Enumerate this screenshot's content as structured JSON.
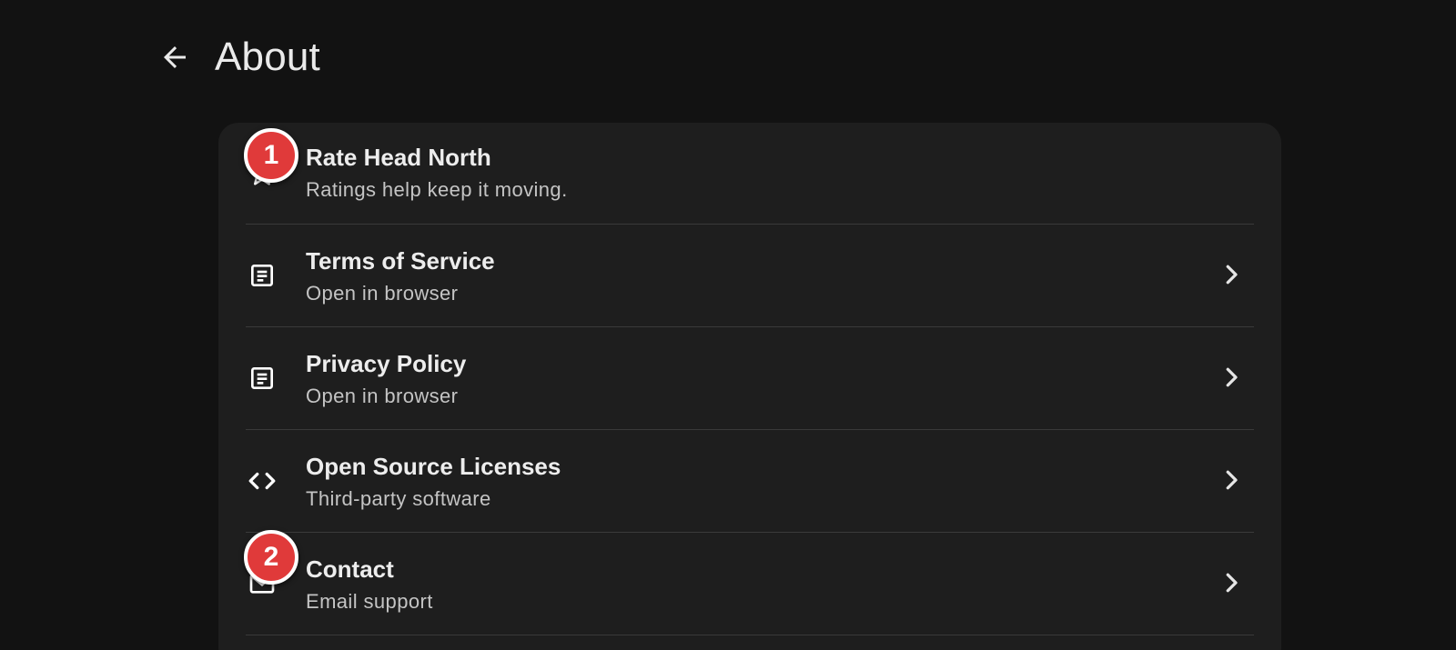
{
  "header": {
    "title": "About",
    "back_icon": "arrow-left-icon"
  },
  "items": [
    {
      "title": "Rate Head North",
      "subtitle": "Ratings help keep it moving.",
      "icon": "star-icon",
      "has_chevron": false
    },
    {
      "title": "Terms of Service",
      "subtitle": "Open in browser",
      "icon": "document-icon",
      "has_chevron": true
    },
    {
      "title": "Privacy Policy",
      "subtitle": "Open in browser",
      "icon": "document-icon",
      "has_chevron": true
    },
    {
      "title": "Open Source Licenses",
      "subtitle": "Third-party software",
      "icon": "code-icon",
      "has_chevron": true
    },
    {
      "title": "Contact",
      "subtitle": "Email support",
      "icon": "mail-icon",
      "has_chevron": true
    }
  ],
  "markers": [
    "1",
    "2"
  ],
  "colors": {
    "background": "#121212",
    "card": "#1e1e1e",
    "marker": "#e03a3a"
  }
}
